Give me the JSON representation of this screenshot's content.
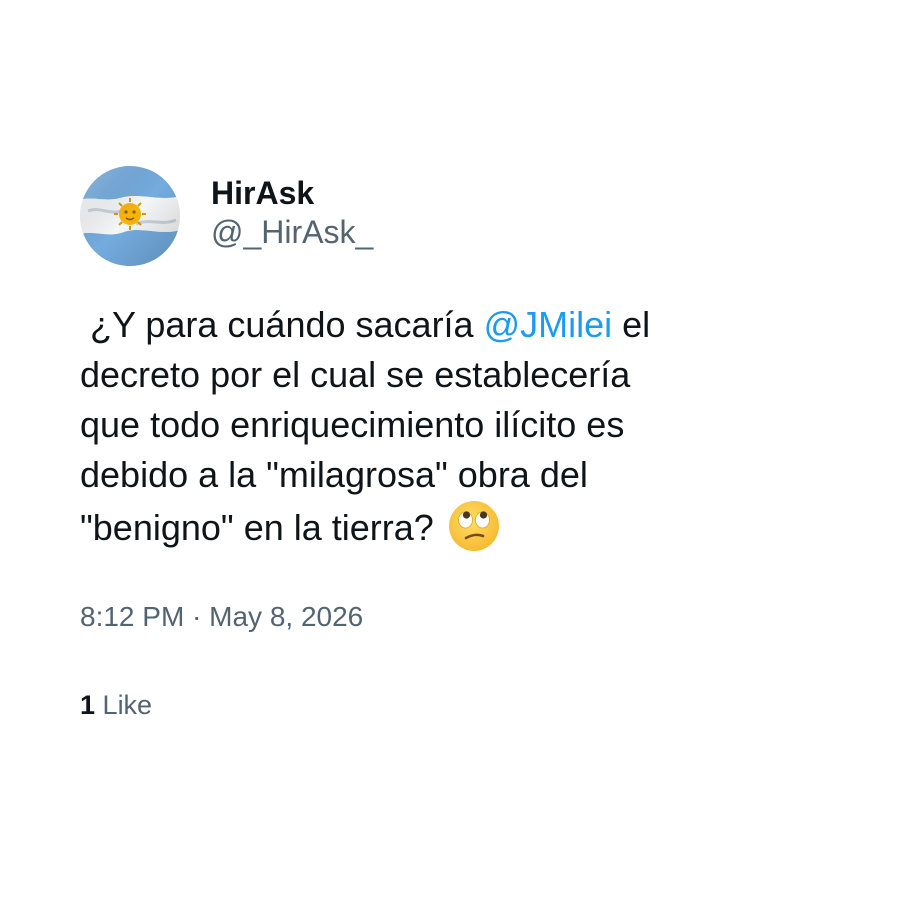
{
  "tweet": {
    "author": {
      "display_name": "HirAsk",
      "handle": "@_HirAsk_",
      "avatar_icon": "argentina-flag-avatar"
    },
    "body": {
      "line1_prefix": " ¿Y para cuándo sacaría ",
      "mention": "@JMilei",
      "line1_suffix": " el",
      "line2": "decreto por el cual se establecería",
      "line3": "que todo enriquecimiento ilícito es",
      "line4": "debido a la \"milagrosa\" obra del",
      "line5": "\"benigno\" en la tierra? ",
      "emoji": "face-with-rolling-eyes-icon"
    },
    "timestamp": "8:12 PM · May 8, 2026",
    "likes": {
      "count": "1",
      "label": "Like"
    }
  },
  "colors": {
    "text_primary": "#0f1419",
    "text_secondary": "#536471",
    "mention": "#1d9bf0",
    "flag_blue": "#74acdf",
    "flag_sun": "#f6b40e"
  }
}
